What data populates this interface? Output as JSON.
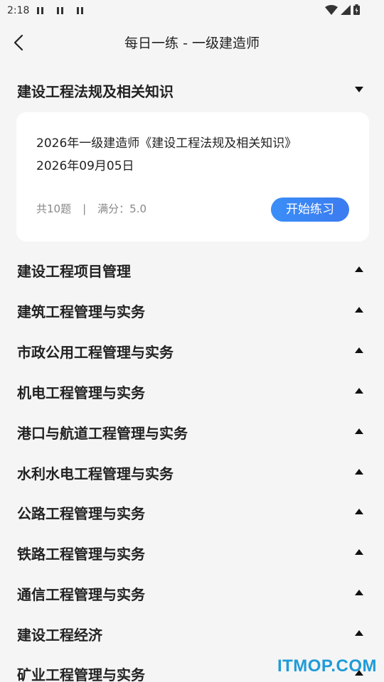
{
  "status_bar": {
    "time": "2:18"
  },
  "header": {
    "title": "每日一练 - 一级建造师"
  },
  "expanded_section": {
    "label": "建设工程法规及相关知识"
  },
  "exam_card": {
    "title": "2026年一级建造师《建设工程法规及相关知识》",
    "date": "2026年09月05日",
    "question_count": "共10题",
    "separator": "|",
    "full_score": "满分：5.0",
    "start_label": "开始练习"
  },
  "sections": [
    {
      "label": "建设工程项目管理"
    },
    {
      "label": "建筑工程管理与实务"
    },
    {
      "label": "市政公用工程管理与实务"
    },
    {
      "label": "机电工程管理与实务"
    },
    {
      "label": "港口与航道工程管理与实务"
    },
    {
      "label": "水利水电工程管理与实务"
    },
    {
      "label": "公路工程管理与实务"
    },
    {
      "label": "铁路工程管理与实务"
    },
    {
      "label": "通信工程管理与实务"
    },
    {
      "label": "建设工程经济"
    },
    {
      "label": "矿业工程管理与实务"
    }
  ],
  "watermark": "ITMOP.COM"
}
